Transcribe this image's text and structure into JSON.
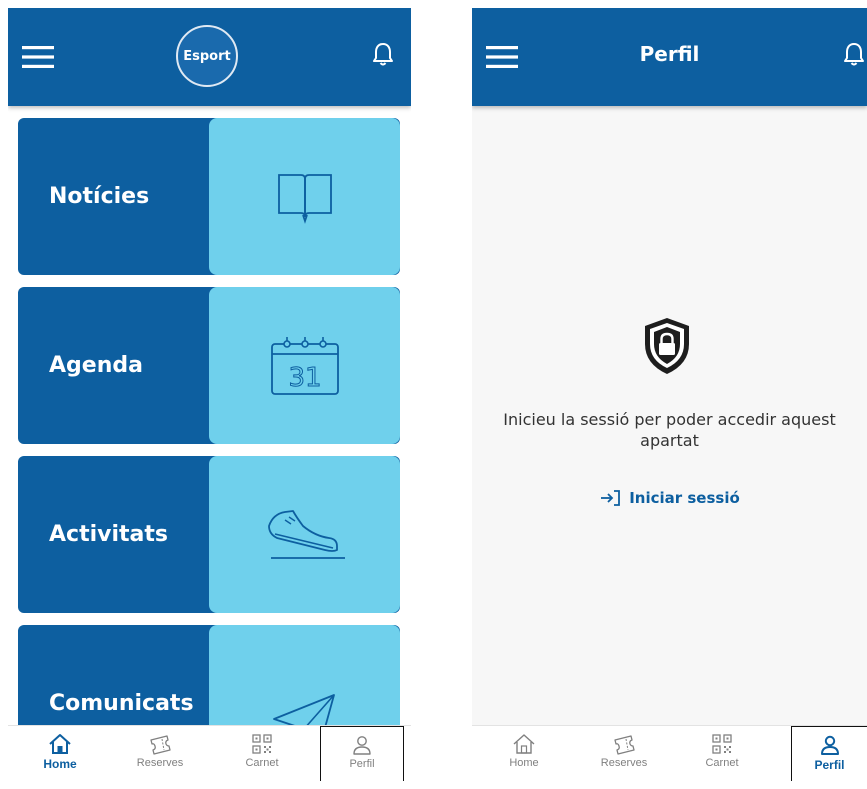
{
  "colors": {
    "primary": "#0d5fa0",
    "tile_accent": "#6fd0ec",
    "inactive": "#808080"
  },
  "home_screen": {
    "logo_text": "Esport",
    "tiles": [
      {
        "label": "Notícies",
        "icon": "book-icon"
      },
      {
        "label": "Agenda",
        "icon": "calendar-icon"
      },
      {
        "label": "Activitats",
        "icon": "sneaker-icon"
      },
      {
        "label": "Comunicats",
        "icon": "paper-plane-icon"
      }
    ],
    "calendar_day": "31"
  },
  "profile_screen": {
    "title": "Perfil",
    "message": "Inicieu la sessió per poder accedir aquest apartat",
    "login_label": "Iniciar sessió"
  },
  "bottom_nav": [
    {
      "label": "Home",
      "icon": "home-icon"
    },
    {
      "label": "Reserves",
      "icon": "ticket-icon"
    },
    {
      "label": "Carnet",
      "icon": "qr-icon"
    },
    {
      "label": "Perfil",
      "icon": "user-icon"
    }
  ],
  "left_active_tab": "Home",
  "right_active_tab": "Perfil"
}
